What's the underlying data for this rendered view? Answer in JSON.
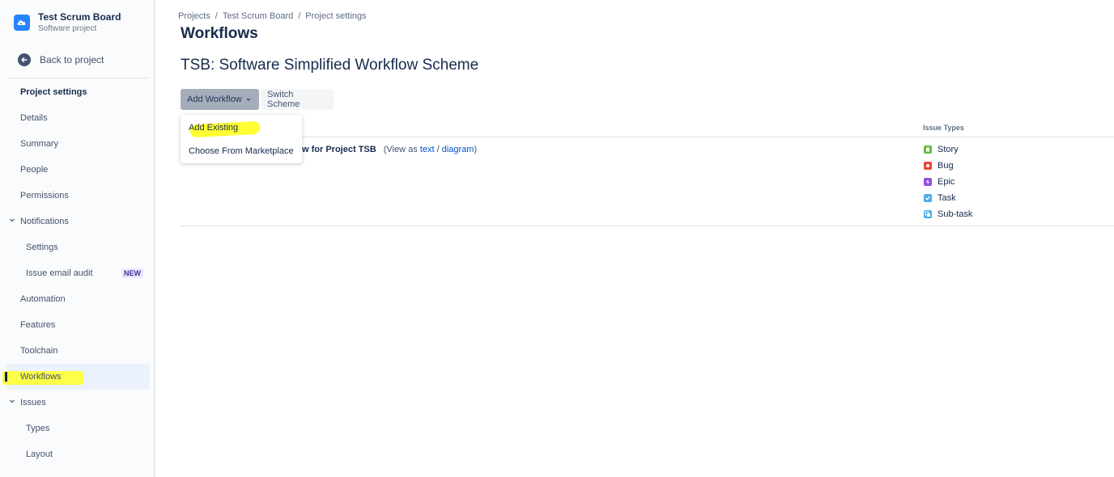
{
  "sidebar": {
    "project_name": "Test Scrum Board",
    "project_type": "Software project",
    "back_label": "Back to project",
    "items": [
      {
        "label": "Project settings"
      },
      {
        "label": "Details"
      },
      {
        "label": "Summary"
      },
      {
        "label": "People"
      },
      {
        "label": "Permissions"
      },
      {
        "label": "Notifications"
      },
      {
        "label": "Settings"
      },
      {
        "label": "Issue email audit",
        "badge": "NEW"
      },
      {
        "label": "Automation"
      },
      {
        "label": "Features"
      },
      {
        "label": "Toolchain"
      },
      {
        "label": "Workflows",
        "active": true
      },
      {
        "label": "Issues"
      },
      {
        "label": "Types"
      },
      {
        "label": "Layout"
      }
    ]
  },
  "breadcrumb": [
    "Projects",
    "Test Scrum Board",
    "Project settings"
  ],
  "page": {
    "title": "Workflows",
    "scheme_title": "TSB: Software Simplified Workflow Scheme",
    "add_workflow_label": "Add Workflow",
    "switch_scheme_label": "Switch Scheme"
  },
  "dropdown": {
    "items": [
      "Add Existing",
      "Choose From Marketplace"
    ]
  },
  "table": {
    "issue_types_header": "Issue Types",
    "workflow_name_visible": "w for Project TSB",
    "view_as_prefix": "(View as ",
    "text_link": "text",
    "slash": " / ",
    "diagram_link": "diagram",
    "view_as_suffix": ")",
    "issue_types": [
      {
        "name": "Story",
        "color": "#63ba3c"
      },
      {
        "name": "Bug",
        "color": "#e5493a"
      },
      {
        "name": "Epic",
        "color": "#904ee2"
      },
      {
        "name": "Task",
        "color": "#4bade8"
      },
      {
        "name": "Sub-task",
        "color": "#4bade8"
      }
    ]
  },
  "colors": {
    "highlight": "#ffff33",
    "link": "#0052cc",
    "project_avatar": "#2684ff"
  }
}
